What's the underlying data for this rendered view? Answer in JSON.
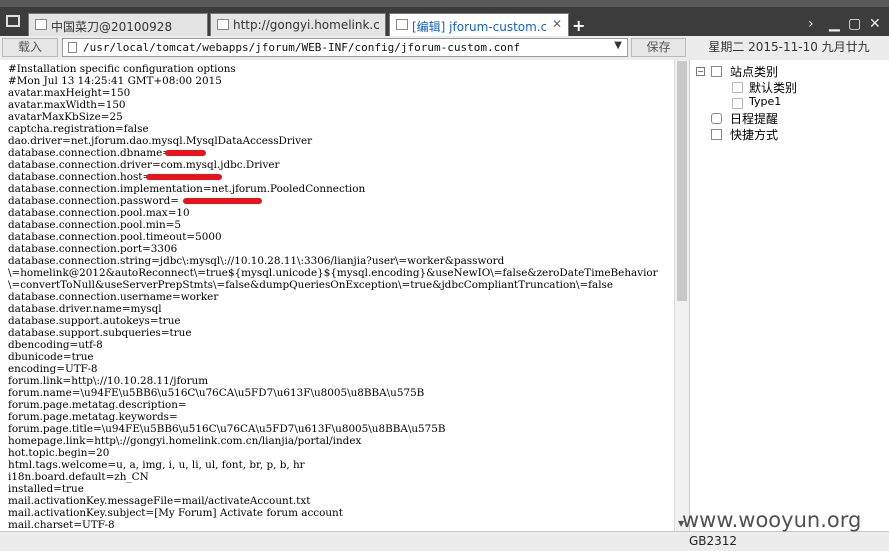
{
  "tabs": [
    {
      "label": "中国菜刀@20100928",
      "icon": "window-icon"
    },
    {
      "label": "http://gongyi.homelink.com.c...",
      "icon": "globe-icon"
    },
    {
      "label": "[编辑] jforum-custom.conf",
      "icon": "document-icon",
      "active": true
    }
  ],
  "toolbar": {
    "load_label": "载入",
    "path": "/usr/local/tomcat/webapps/jforum/WEB-INF/config/jforum-custom.conf",
    "save_label": "保存",
    "date": "星期二 2015-11-10 九月廿九"
  },
  "editor": {
    "lines": [
      "#Installation specific configuration options",
      "#Mon Jul 13 14:25:41 GMT+08:00 2015",
      "avatar.maxHeight=150",
      "avatar.maxWidth=150",
      "avatarMaxKbSize=25",
      "captcha.registration=false",
      "dao.driver=net.jforum.dao.mysql.MysqlDataAccessDriver",
      "database.connection.dbname=",
      "database.connection.driver=com.mysql.jdbc.Driver",
      "database.connection.host=",
      "database.connection.implementation=net.jforum.PooledConnection",
      "database.connection.password=",
      "database.connection.pool.max=10",
      "database.connection.pool.min=5",
      "database.connection.pool.timeout=5000",
      "database.connection.port=3306",
      "database.connection.string=jdbc\\:mysql\\://10.10.28.11\\:3306/lianjia?user\\=worker&password",
      "\\=homelink@2012&autoReconnect\\=true${mysql.unicode}${mysql.encoding}&useNewIO\\=false&zeroDateTimeBehavior",
      "\\=convertToNull&useServerPrepStmts\\=false&dumpQueriesOnException\\=true&jdbcCompliantTruncation\\=false",
      "database.connection.username=worker",
      "database.driver.name=mysql",
      "database.support.autokeys=true",
      "database.support.subqueries=true",
      "dbencoding=utf-8",
      "dbunicode=true",
      "encoding=UTF-8",
      "forum.link=http\\://10.10.28.11/jforum",
      "forum.name=\\u94FE\\u5BB6\\u516C\\u76CA\\u5FD7\\u613F\\u8005\\u8BBA\\u575B",
      "forum.page.metatag.description=",
      "forum.page.metatag.keywords=",
      "forum.page.title=\\u94FE\\u5BB6\\u516C\\u76CA\\u5FD7\\u613F\\u8005\\u8BBA\\u575B",
      "homepage.link=http\\://gongyi.homelink.com.cn/lianjia/portal/index",
      "hot.topic.begin=20",
      "html.tags.welcome=u, a, img, i, u, li, ul, font, br, p, b, hr",
      "i18n.board.default=zh_CN",
      "installed=true",
      "mail.activationKey.messageFile=mail/activateAccount.txt",
      "mail.activationKey.subject=[My Forum] Activate forum account",
      "mail.charset=UTF-8"
    ]
  },
  "tree": {
    "root": {
      "label": "站点类别"
    },
    "children": [
      {
        "label": "默认类别"
      },
      {
        "label": "Type1"
      }
    ],
    "schedule": {
      "label": "日程提醒"
    },
    "shortcuts": {
      "label": "快捷方式"
    }
  },
  "status": {
    "encoding": "GB2312"
  },
  "watermark": "www.wooyun.org",
  "colors": {
    "redaction": "#e8141c",
    "active_tab_text": "#1a5fb4",
    "tabbar": "#3c3c3c"
  }
}
